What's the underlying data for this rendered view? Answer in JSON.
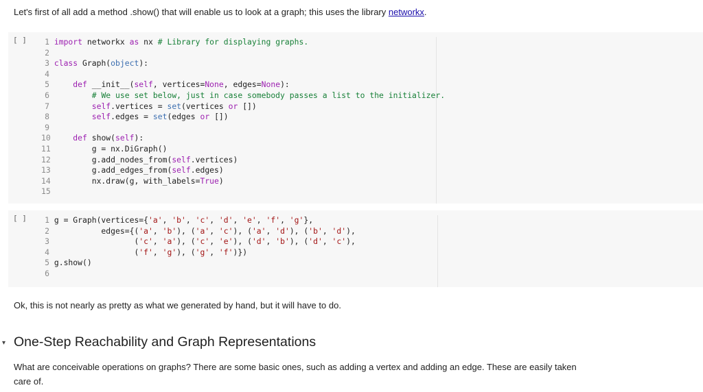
{
  "intro": {
    "before": "Let's first of all add a method .show() that will enable us to look at a graph; this uses the library ",
    "link": "networkx",
    "after": "."
  },
  "run_button_label": "[ ]",
  "cell1": {
    "lines": [
      {
        "n": "1",
        "indent": "",
        "text": "import networkx as nx # Library for displaying graphs."
      },
      {
        "n": "2",
        "indent": "",
        "text": ""
      },
      {
        "n": "3",
        "indent": "",
        "text": "class Graph(object):"
      },
      {
        "n": "4",
        "indent": "",
        "text": ""
      },
      {
        "n": "5",
        "indent": "    ",
        "text": "def __init__(self, vertices=None, edges=None):"
      },
      {
        "n": "6",
        "indent": "        ",
        "text": "# We use set below, just in case somebody passes a list to the initializer."
      },
      {
        "n": "7",
        "indent": "        ",
        "text": "self.vertices = set(vertices or [])"
      },
      {
        "n": "8",
        "indent": "        ",
        "text": "self.edges = set(edges or [])"
      },
      {
        "n": "9",
        "indent": "",
        "text": ""
      },
      {
        "n": "10",
        "indent": "    ",
        "text": "def show(self):"
      },
      {
        "n": "11",
        "indent": "        ",
        "text": "g = nx.DiGraph()"
      },
      {
        "n": "12",
        "indent": "        ",
        "text": "g.add_nodes_from(self.vertices)"
      },
      {
        "n": "13",
        "indent": "        ",
        "text": "g.add_edges_from(self.edges)"
      },
      {
        "n": "14",
        "indent": "        ",
        "text": "nx.draw(g, with_labels=True)"
      },
      {
        "n": "15",
        "indent": "",
        "text": ""
      }
    ]
  },
  "cell2": {
    "lines": [
      {
        "n": "1",
        "indent": "",
        "text": "g = Graph(vertices={'a', 'b', 'c', 'd', 'e', 'f', 'g'},"
      },
      {
        "n": "2",
        "indent": "          ",
        "text": "edges={('a', 'b'), ('a', 'c'), ('a', 'd'), ('b', 'd'),"
      },
      {
        "n": "3",
        "indent": "                 ",
        "text": "('c', 'a'), ('c', 'e'), ('d', 'b'), ('d', 'c'),"
      },
      {
        "n": "4",
        "indent": "                 ",
        "text": "('f', 'g'), ('g', 'f')})"
      },
      {
        "n": "5",
        "indent": "",
        "text": "g.show()"
      },
      {
        "n": "6",
        "indent": "",
        "text": ""
      }
    ]
  },
  "outro": "Ok, this is not nearly as pretty as what we generated by hand, but it will have to do.",
  "section": {
    "toggle_icon": "▾",
    "heading": "One-Step Reachability and Graph Representations",
    "paragraph": "What are conceivable operations on graphs? There are some basic ones, such as adding a vertex and adding an edge. These are easily taken care of."
  }
}
